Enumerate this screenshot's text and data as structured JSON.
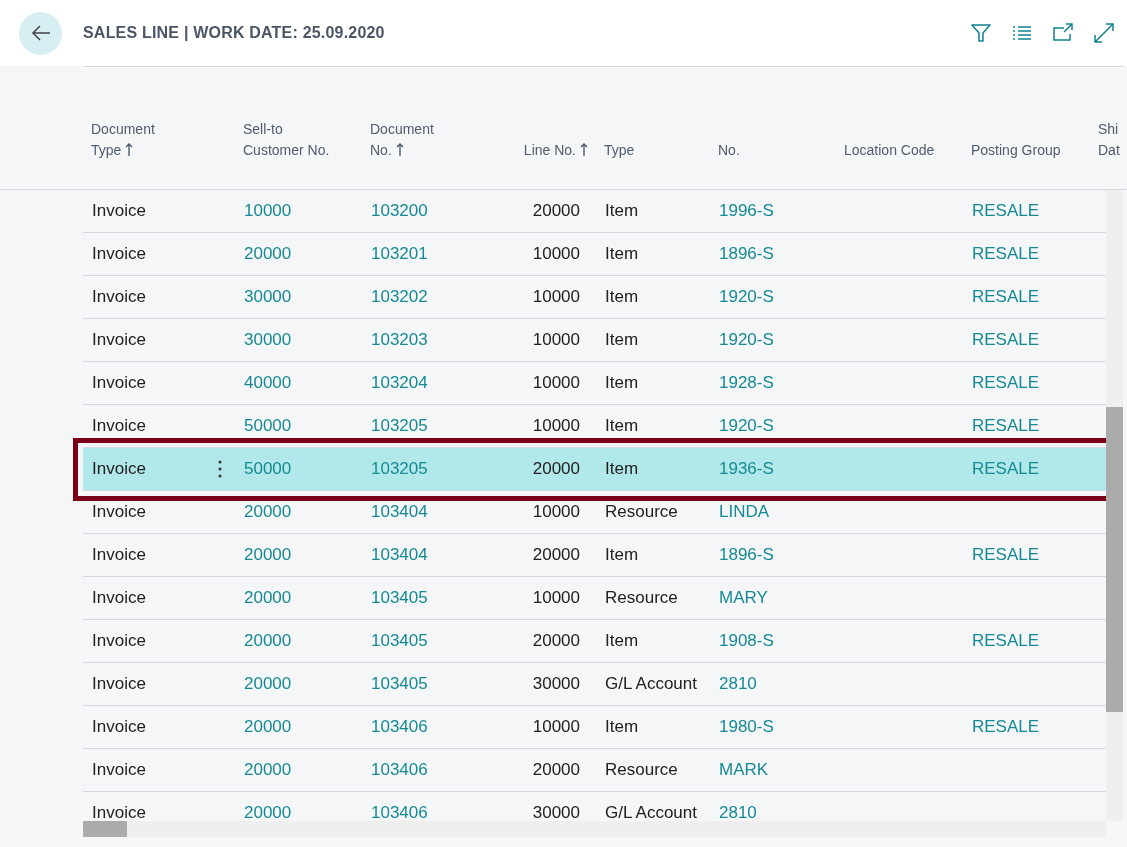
{
  "header": {
    "title": "SALES LINE | WORK DATE: 25.09.2020"
  },
  "table": {
    "columns": [
      {
        "label": "Document Type",
        "sorted": true
      },
      {
        "label": "Sell-to Customer No.",
        "sorted": false
      },
      {
        "label": "Document No.",
        "sorted": true
      },
      {
        "label": "Line No.",
        "sorted": true
      },
      {
        "label": "Type",
        "sorted": false
      },
      {
        "label": "No.",
        "sorted": false
      },
      {
        "label": "Location Code",
        "sorted": false
      },
      {
        "label": "Posting Group",
        "sorted": false
      },
      {
        "label": "Shi Dat",
        "sorted": false
      }
    ],
    "rows": [
      {
        "document_type": "Invoice",
        "customer_no": "10000",
        "document_no": "103200",
        "line_no": "20000",
        "type": "Item",
        "no": "1996-S",
        "posting_group": "RESALE",
        "selected": false
      },
      {
        "document_type": "Invoice",
        "customer_no": "20000",
        "document_no": "103201",
        "line_no": "10000",
        "type": "Item",
        "no": "1896-S",
        "posting_group": "RESALE",
        "selected": false
      },
      {
        "document_type": "Invoice",
        "customer_no": "30000",
        "document_no": "103202",
        "line_no": "10000",
        "type": "Item",
        "no": "1920-S",
        "posting_group": "RESALE",
        "selected": false
      },
      {
        "document_type": "Invoice",
        "customer_no": "30000",
        "document_no": "103203",
        "line_no": "10000",
        "type": "Item",
        "no": "1920-S",
        "posting_group": "RESALE",
        "selected": false
      },
      {
        "document_type": "Invoice",
        "customer_no": "40000",
        "document_no": "103204",
        "line_no": "10000",
        "type": "Item",
        "no": "1928-S",
        "posting_group": "RESALE",
        "selected": false
      },
      {
        "document_type": "Invoice",
        "customer_no": "50000",
        "document_no": "103205",
        "line_no": "10000",
        "type": "Item",
        "no": "1920-S",
        "posting_group": "RESALE",
        "selected": false
      },
      {
        "document_type": "Invoice",
        "customer_no": "50000",
        "document_no": "103205",
        "line_no": "20000",
        "type": "Item",
        "no": "1936-S",
        "posting_group": "RESALE",
        "selected": true
      },
      {
        "document_type": "Invoice",
        "customer_no": "20000",
        "document_no": "103404",
        "line_no": "10000",
        "type": "Resource",
        "no": "LINDA",
        "selected": false
      },
      {
        "document_type": "Invoice",
        "customer_no": "20000",
        "document_no": "103404",
        "line_no": "20000",
        "type": "Item",
        "no": "1896-S",
        "posting_group": "RESALE",
        "selected": false
      },
      {
        "document_type": "Invoice",
        "customer_no": "20000",
        "document_no": "103405",
        "line_no": "10000",
        "type": "Resource",
        "no": "MARY",
        "selected": false
      },
      {
        "document_type": "Invoice",
        "customer_no": "20000",
        "document_no": "103405",
        "line_no": "20000",
        "type": "Item",
        "no": "1908-S",
        "posting_group": "RESALE",
        "selected": false
      },
      {
        "document_type": "Invoice",
        "customer_no": "20000",
        "document_no": "103405",
        "line_no": "30000",
        "type": "G/L Account",
        "no": "2810",
        "selected": false
      },
      {
        "document_type": "Invoice",
        "customer_no": "20000",
        "document_no": "103406",
        "line_no": "10000",
        "type": "Item",
        "no": "1980-S",
        "posting_group": "RESALE",
        "selected": false
      },
      {
        "document_type": "Invoice",
        "customer_no": "20000",
        "document_no": "103406",
        "line_no": "20000",
        "type": "Resource",
        "no": "MARK",
        "selected": false
      },
      {
        "document_type": "Invoice",
        "customer_no": "20000",
        "document_no": "103406",
        "line_no": "30000",
        "type": "G/L Account",
        "no": "2810",
        "selected": false
      }
    ]
  }
}
